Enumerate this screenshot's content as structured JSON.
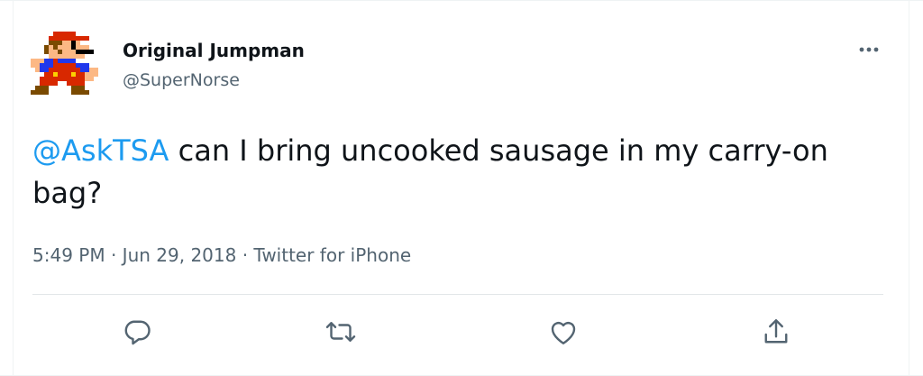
{
  "tweet": {
    "author": {
      "display_name": "Original Jumpman",
      "handle": "@SuperNorse",
      "avatar_icon": "pixel-mario-avatar"
    },
    "text": {
      "mention": "@AskTSA",
      "body": " can I bring uncooked sausage in my carry-on bag?"
    },
    "meta": {
      "time": "5:49 PM",
      "separator": " · ",
      "date": "Jun 29, 2018",
      "source": "Twitter for iPhone"
    },
    "actions": {
      "more_icon": "more-icon",
      "reply_icon": "reply-icon",
      "retweet_icon": "retweet-icon",
      "like_icon": "heart-icon",
      "share_icon": "share-icon"
    }
  },
  "colors": {
    "text": "#0f1419",
    "secondary": "#536471",
    "accent": "#1d9bf0",
    "divider": "#eff3f4"
  }
}
